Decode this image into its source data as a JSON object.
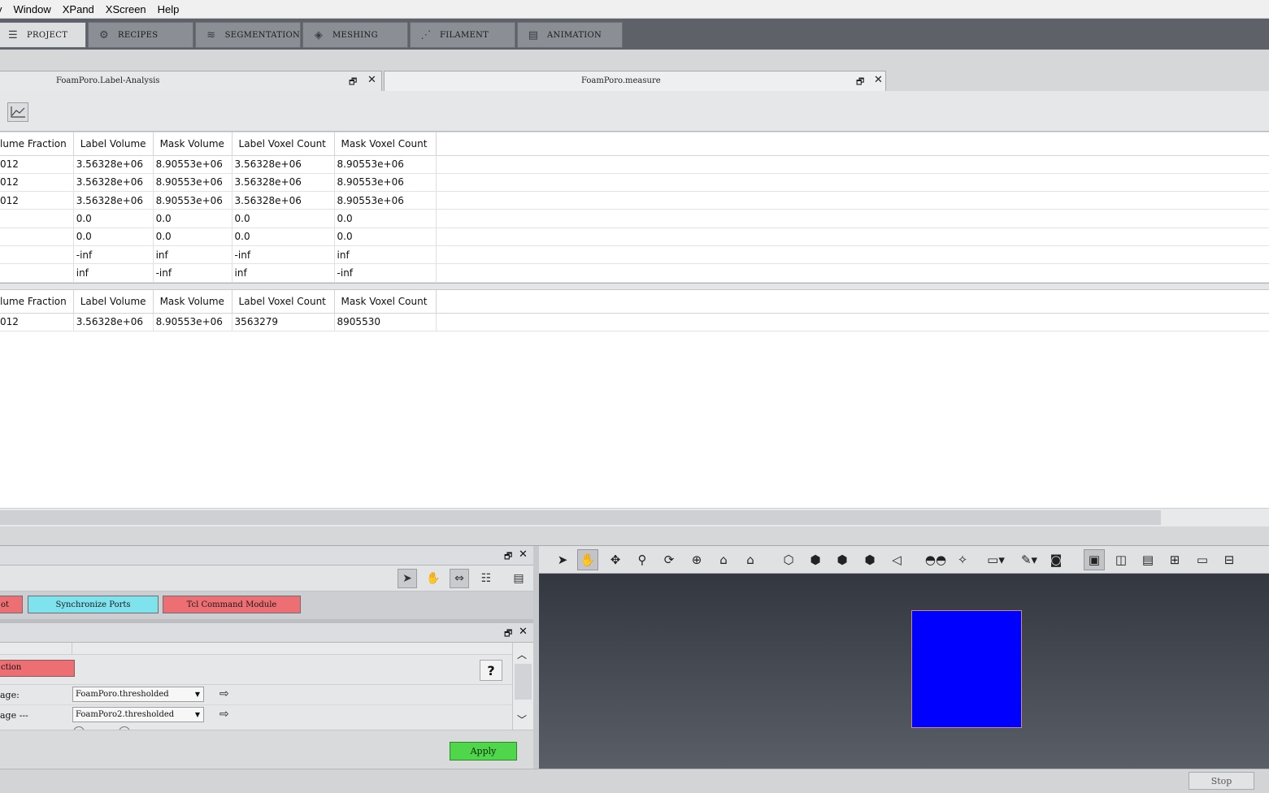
{
  "menubar": [
    "Window",
    "XPand",
    "XScreen",
    "Help"
  ],
  "workrooms": [
    {
      "label": "PROJECT",
      "icon": "project-icon",
      "active": true
    },
    {
      "label": "RECIPES",
      "icon": "gears-icon",
      "active": false
    },
    {
      "label": "SEGMENTATION",
      "icon": "layers-icon",
      "active": false
    },
    {
      "label": "MESHING",
      "icon": "mesh-icon",
      "active": false
    },
    {
      "label": "FILAMENT",
      "icon": "filament-icon",
      "active": false
    },
    {
      "label": "ANIMATION",
      "icon": "clapper-icon",
      "active": false
    }
  ],
  "doc_tabs": [
    {
      "label": "FoamPoro.Label-Analysis"
    },
    {
      "label": "FoamPoro.measure"
    }
  ],
  "table1": {
    "headers": [
      "lume Fraction",
      "Label Volume",
      "Mask Volume",
      "Label Voxel Count",
      "Mask Voxel Count"
    ],
    "rows": [
      [
        "012",
        "3.56328e+06",
        "8.90553e+06",
        "3.56328e+06",
        "8.90553e+06"
      ],
      [
        "012",
        "3.56328e+06",
        "8.90553e+06",
        "3.56328e+06",
        "8.90553e+06"
      ],
      [
        "012",
        "3.56328e+06",
        "8.90553e+06",
        "3.56328e+06",
        "8.90553e+06"
      ],
      [
        "",
        "0.0",
        "0.0",
        "0.0",
        "0.0"
      ],
      [
        "",
        "0.0",
        "0.0",
        "0.0",
        "0.0"
      ],
      [
        "",
        "-inf",
        "inf",
        "-inf",
        "inf"
      ],
      [
        "",
        "inf",
        "-inf",
        "inf",
        "-inf"
      ]
    ]
  },
  "table2": {
    "headers": [
      "lume Fraction",
      "Label Volume",
      "Mask Volume",
      "Label Voxel Count",
      "Mask Voxel Count"
    ],
    "rows": [
      [
        "012",
        "3.56328e+06",
        "8.90553e+06",
        "3563279",
        "8905530"
      ]
    ]
  },
  "project_modules": [
    {
      "label": "ot",
      "color": "#ee6f73"
    },
    {
      "label": "Synchronize Ports",
      "color": "#7fe3ee"
    },
    {
      "label": "Tcl Command Module",
      "color": "#ee6f73"
    }
  ],
  "properties": {
    "module_label": "ction",
    "module_color": "#ee6f73",
    "help": "?",
    "rows": [
      {
        "label": "age:",
        "value": "FoamPoro.thresholded"
      },
      {
        "label": "age ---",
        "value": "FoamPoro2.thresholded"
      }
    ],
    "apply": "Apply"
  },
  "status": {
    "stop": "Stop"
  },
  "colors": {
    "viewer_object": "#0000ff",
    "apply": "#4fd64a"
  }
}
